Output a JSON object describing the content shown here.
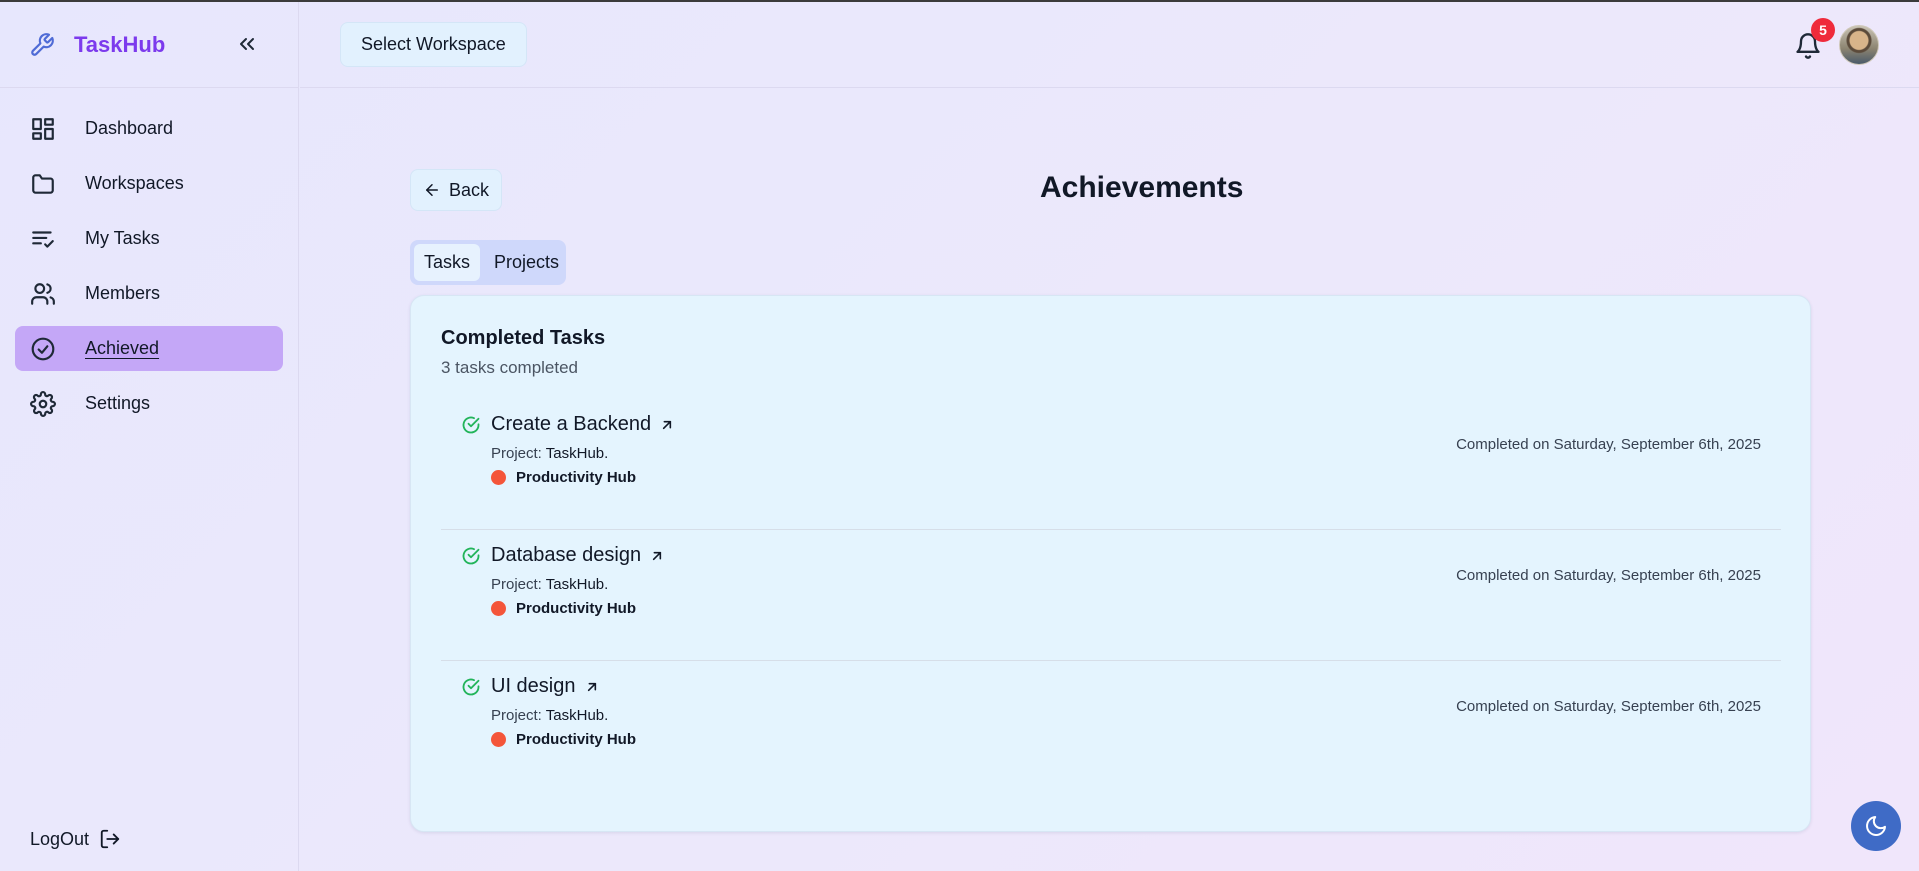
{
  "app": {
    "name": "TaskHub"
  },
  "sidebar": {
    "items": [
      {
        "label": "Dashboard",
        "icon": "dashboard-icon",
        "active": false
      },
      {
        "label": "Workspaces",
        "icon": "folder-icon",
        "active": false
      },
      {
        "label": "My Tasks",
        "icon": "list-check-icon",
        "active": false
      },
      {
        "label": "Members",
        "icon": "users-icon",
        "active": false
      },
      {
        "label": "Achieved",
        "icon": "check-circle-icon",
        "active": true
      },
      {
        "label": "Settings",
        "icon": "gear-icon",
        "active": false
      }
    ],
    "logout_label": "LogOut"
  },
  "header": {
    "workspace_button": "Select Workspace",
    "notification_count": "5"
  },
  "main": {
    "back_label": "Back",
    "title": "Achievements",
    "tabs": [
      {
        "label": "Tasks",
        "active": true
      },
      {
        "label": "Projects",
        "active": false
      }
    ],
    "card": {
      "title": "Completed Tasks",
      "subtitle": "3 tasks completed",
      "project_prefix": "Project:",
      "tasks": [
        {
          "name": "Create a Backend",
          "project": "TaskHub.",
          "workspace": "Productivity Hub",
          "completed": "Completed on Saturday, September 6th, 2025"
        },
        {
          "name": "Database design",
          "project": "TaskHub.",
          "workspace": "Productivity Hub",
          "completed": "Completed on Saturday, September 6th, 2025"
        },
        {
          "name": "UI design",
          "project": "TaskHub.",
          "workspace": "Productivity Hub",
          "completed": "Completed on Saturday, September 6th, 2025"
        }
      ]
    }
  },
  "colors": {
    "brand": "#7c3aed",
    "active_nav": "#c4a7f7",
    "success": "#22b45a",
    "workspace_dot": "#f4553a",
    "badge": "#ef2b3b",
    "theme_button": "#3f6bc6"
  }
}
